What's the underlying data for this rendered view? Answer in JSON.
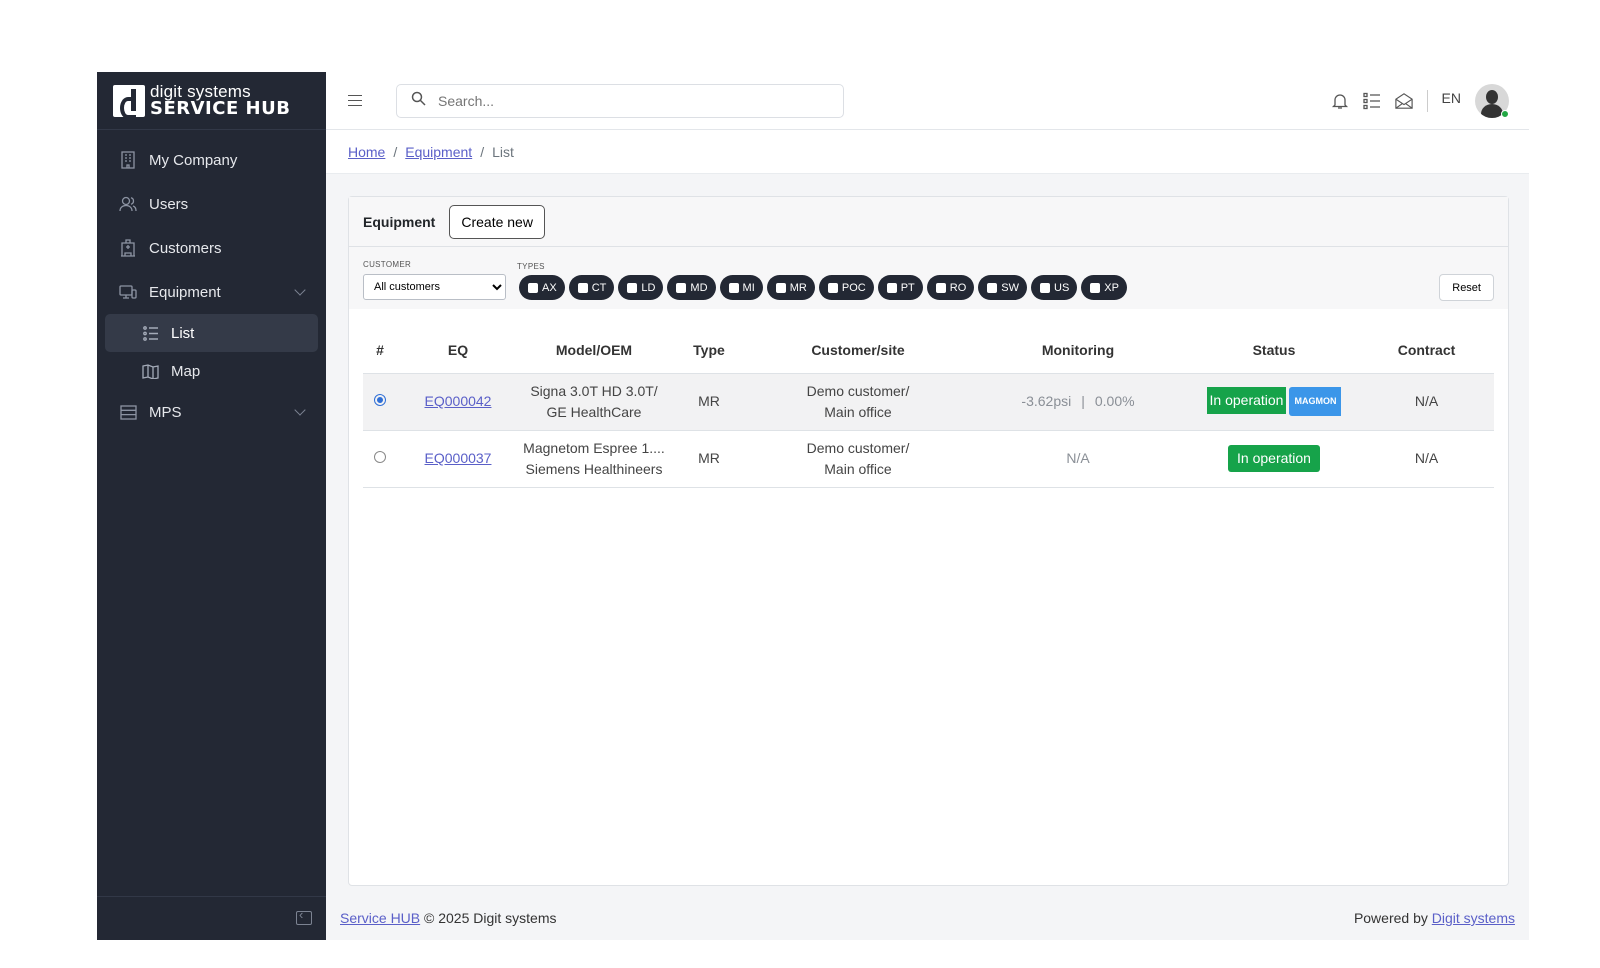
{
  "brand": {
    "top": "digit systems",
    "bottom": "SERVICE HUB"
  },
  "sidebar": {
    "items": [
      {
        "label": "My Company",
        "icon": "building-icon"
      },
      {
        "label": "Users",
        "icon": "users-icon"
      },
      {
        "label": "Customers",
        "icon": "hospital-icon"
      },
      {
        "label": "Equipment",
        "icon": "devices-icon",
        "expanded": true
      },
      {
        "label": "MPS",
        "icon": "server-icon"
      }
    ],
    "equipment_sub": [
      {
        "label": "List",
        "icon": "list-icon",
        "active": true
      },
      {
        "label": "Map",
        "icon": "map-icon"
      }
    ]
  },
  "topbar": {
    "search_placeholder": "Search...",
    "lang": "EN"
  },
  "breadcrumb": {
    "home": "Home",
    "equipment": "Equipment",
    "current": "List",
    "sep": "/"
  },
  "card": {
    "title": "Equipment",
    "create_label": "Create new",
    "filters": {
      "customer_label": "CUSTOMER",
      "customer_value": "All customers",
      "types_label": "TYPES",
      "types": [
        "AX",
        "CT",
        "LD",
        "MD",
        "MI",
        "MR",
        "POC",
        "PT",
        "RO",
        "SW",
        "US",
        "XP"
      ],
      "reset_label": "Reset"
    },
    "table": {
      "headers": [
        "#",
        "EQ",
        "Model/OEM",
        "Type",
        "Customer/site",
        "Monitoring",
        "Status",
        "Contract"
      ],
      "rows": [
        {
          "selected": true,
          "eq": "EQ000042",
          "model": "Signa 3.0T HD 3.0T/",
          "oem": "GE HealthCare",
          "type": "MR",
          "customer": "Demo customer/",
          "site": "Main office",
          "mon_a": "-3.62psi",
          "mon_sep": "|",
          "mon_b": "0.00%",
          "status": "In operation",
          "tag": "MAGMON",
          "contract": "N/A"
        },
        {
          "selected": false,
          "eq": "EQ000037",
          "model": "Magnetom Espree 1....",
          "oem": "Siemens Healthineers",
          "type": "MR",
          "customer": "Demo customer/",
          "site": "Main office",
          "mon": "N/A",
          "status": "In operation",
          "contract": "N/A"
        }
      ]
    }
  },
  "footer": {
    "link": "Service HUB",
    "copy": "© 2025 Digit systems",
    "powered": "Powered by",
    "powered_link": "Digit systems"
  },
  "colors": {
    "sidebar_bg": "#232834",
    "status_green": "#16a34a",
    "tag_blue": "#3b96e9",
    "link": "#5a5fc8"
  }
}
